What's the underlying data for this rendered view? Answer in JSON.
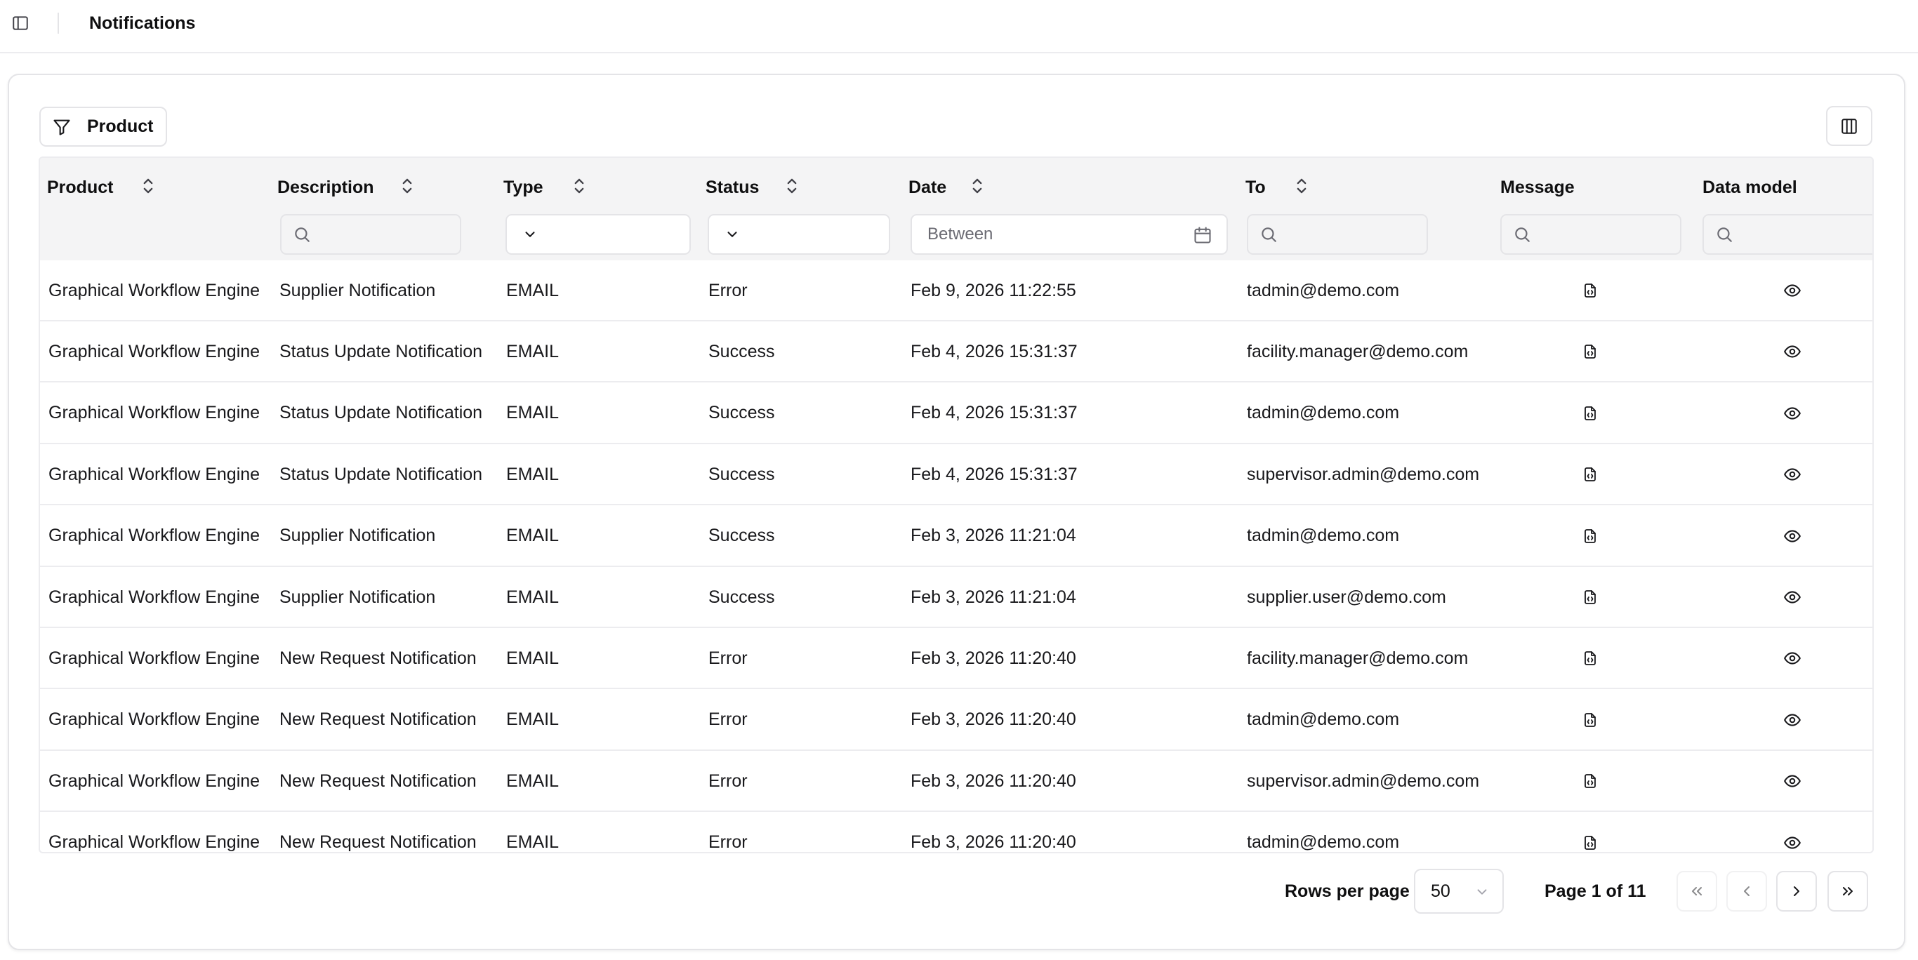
{
  "header": {
    "title": "Notifications",
    "sidebar_toggle_icon": "sidebar-panel-icon"
  },
  "toolbar": {
    "filter_label": "Product",
    "filter_icon": "filter-funnel-icon",
    "columns_icon": "columns-icon"
  },
  "table": {
    "columns": [
      {
        "label": "Product",
        "sortable": true
      },
      {
        "label": "Description",
        "sortable": true
      },
      {
        "label": "Type",
        "sortable": true
      },
      {
        "label": "Status",
        "sortable": true
      },
      {
        "label": "Date",
        "sortable": true
      },
      {
        "label": "To",
        "sortable": true
      },
      {
        "label": "Message",
        "sortable": false
      },
      {
        "label": "Data model",
        "sortable": false
      }
    ],
    "filters": {
      "date_placeholder": "Between"
    },
    "rows": [
      {
        "product": "Graphical Workflow Engine",
        "description": "Supplier Notification",
        "type": "EMAIL",
        "status": "Error",
        "date": "Feb 9, 2026 11:22:55",
        "to": "tadmin@demo.com"
      },
      {
        "product": "Graphical Workflow Engine",
        "description": "Status Update Notification",
        "type": "EMAIL",
        "status": "Success",
        "date": "Feb 4, 2026 15:31:37",
        "to": "facility.manager@demo.com"
      },
      {
        "product": "Graphical Workflow Engine",
        "description": "Status Update Notification",
        "type": "EMAIL",
        "status": "Success",
        "date": "Feb 4, 2026 15:31:37",
        "to": "tadmin@demo.com"
      },
      {
        "product": "Graphical Workflow Engine",
        "description": "Status Update Notification",
        "type": "EMAIL",
        "status": "Success",
        "date": "Feb 4, 2026 15:31:37",
        "to": "supervisor.admin@demo.com"
      },
      {
        "product": "Graphical Workflow Engine",
        "description": "Supplier Notification",
        "type": "EMAIL",
        "status": "Success",
        "date": "Feb 3, 2026 11:21:04",
        "to": "tadmin@demo.com"
      },
      {
        "product": "Graphical Workflow Engine",
        "description": "Supplier Notification",
        "type": "EMAIL",
        "status": "Success",
        "date": "Feb 3, 2026 11:21:04",
        "to": "supplier.user@demo.com"
      },
      {
        "product": "Graphical Workflow Engine",
        "description": "New Request Notification",
        "type": "EMAIL",
        "status": "Error",
        "date": "Feb 3, 2026 11:20:40",
        "to": "facility.manager@demo.com"
      },
      {
        "product": "Graphical Workflow Engine",
        "description": "New Request Notification",
        "type": "EMAIL",
        "status": "Error",
        "date": "Feb 3, 2026 11:20:40",
        "to": "tadmin@demo.com"
      },
      {
        "product": "Graphical Workflow Engine",
        "description": "New Request Notification",
        "type": "EMAIL",
        "status": "Error",
        "date": "Feb 3, 2026 11:20:40",
        "to": "supervisor.admin@demo.com"
      },
      {
        "product": "Graphical Workflow Engine",
        "description": "New Request Notification",
        "type": "EMAIL",
        "status": "Error",
        "date": "Feb 3, 2026 11:20:40",
        "to": "tadmin@demo.com"
      }
    ],
    "row_icons": {
      "message": "file-code-icon",
      "data_model": "eye-icon"
    }
  },
  "pagination": {
    "rows_per_page_label": "Rows per page",
    "rows_per_page_value": "50",
    "page_info": "Page 1 of 11",
    "buttons": [
      "first-page-icon",
      "previous-page-icon",
      "next-page-icon",
      "last-page-icon"
    ]
  },
  "colors": {
    "border": "#e4e4e7",
    "header_bg": "#f4f4f5",
    "text": "#18181b",
    "muted": "#6b6b73"
  }
}
